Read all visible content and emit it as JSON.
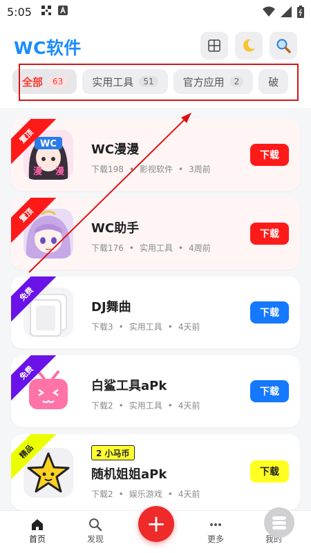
{
  "status_bar": {
    "time": "5:05"
  },
  "header": {
    "title": "WC软件"
  },
  "tabs": [
    {
      "label": "全部",
      "count": "63",
      "active": true
    },
    {
      "label": "实用工具",
      "count": "51"
    },
    {
      "label": "官方应用",
      "count": "2"
    },
    {
      "label": "破"
    }
  ],
  "apps": [
    {
      "name": "WC漫漫",
      "ribbon": "置顶",
      "downloads": "下载198",
      "category": "影视软件",
      "time": "3周前",
      "button": "下载",
      "ribbon_color": "#ff1a1a",
      "button_color": "#ff1a1a"
    },
    {
      "name": "WC助手",
      "ribbon": "置顶",
      "downloads": "下载176",
      "category": "实用工具",
      "time": "4周前",
      "button": "下载",
      "ribbon_color": "#ff1a1a",
      "button_color": "#ff1a1a"
    },
    {
      "name": "DJ舞曲",
      "ribbon": "免费",
      "downloads": "下载3",
      "category": "实用工具",
      "time": "4天前",
      "button": "下载",
      "ribbon_color": "#6a12e8",
      "button_color": "#1677ff"
    },
    {
      "name": "白鲨工具aPk",
      "ribbon": "免费",
      "downloads": "下载2",
      "category": "实用工具",
      "time": "4天前",
      "button": "下载",
      "ribbon_color": "#6a12e8",
      "button_color": "#1677ff"
    },
    {
      "name": "随机姐姐aPk",
      "ribbon": "精品",
      "badge": "2 小马币",
      "downloads": "下载2",
      "category": "娱乐游戏",
      "time": "4天前",
      "button": "下载",
      "ribbon_color": "#eaff00",
      "button_color": "#ffff22"
    }
  ],
  "bottom_nav": [
    {
      "label": "首页",
      "icon": "home-icon"
    },
    {
      "label": "发现",
      "icon": "search-icon"
    },
    {
      "label": "更多",
      "icon": "more-icon"
    },
    {
      "label": "我的",
      "icon": "profile-icon"
    }
  ],
  "fab": {
    "label": "+"
  }
}
